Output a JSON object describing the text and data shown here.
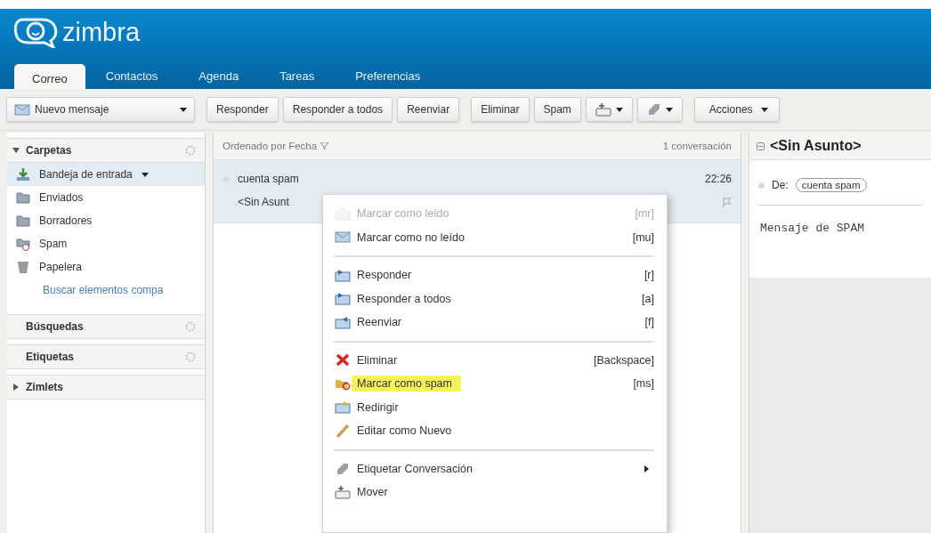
{
  "app": {
    "logo": "zimbra"
  },
  "tabs": [
    {
      "label": "Correo",
      "selected": true
    },
    {
      "label": "Contactos",
      "selected": false
    },
    {
      "label": "Agenda",
      "selected": false
    },
    {
      "label": "Tareas",
      "selected": false
    },
    {
      "label": "Preferencias",
      "selected": false
    }
  ],
  "toolbar": {
    "new_button": "Nuevo mensaje",
    "buttons": [
      {
        "kind": "text",
        "label": "Responder"
      },
      {
        "kind": "text",
        "label": "Responder a todos"
      },
      {
        "kind": "text",
        "label": "Reenviar"
      },
      {
        "kind": "text",
        "label": "Eliminar"
      },
      {
        "kind": "text",
        "label": "Spam"
      },
      {
        "kind": "move"
      },
      {
        "kind": "tag"
      },
      {
        "kind": "menu",
        "label": "Acciones"
      }
    ]
  },
  "sidebar": {
    "sections": [
      {
        "title": "Carpetas",
        "expanded": true,
        "items": [
          {
            "label": "Bandeja de entrada",
            "selected": true
          },
          {
            "label": "Enviados",
            "selected": false
          },
          {
            "label": "Borradores",
            "selected": false
          },
          {
            "label": "Spam",
            "selected": false
          },
          {
            "label": "Papelera",
            "selected": false
          }
        ],
        "link": "Buscar elementos compa"
      },
      {
        "title": "Búsquedas"
      },
      {
        "title": "Etiquetas"
      },
      {
        "title": "Zimlets",
        "expanded": false
      }
    ]
  },
  "message_list": {
    "sort_label": "Ordenado por Fecha",
    "count": "1 conversación",
    "rows": [
      {
        "sender": "cuenta spam",
        "time": "22:26",
        "subject": "<Sin Asunt",
        "selected": true
      }
    ]
  },
  "reading_pane": {
    "subject": "<Sin Asunto>",
    "from_label": "De:",
    "from": "cuenta spam",
    "body": "Mensaje de SPAM"
  },
  "context_menu": {
    "items": [
      {
        "kind": "item",
        "label": "Marcar como leído",
        "shortcut": "[mr]",
        "disabled": true,
        "highlighted": false
      },
      {
        "kind": "item",
        "label": "Marcar como no leído",
        "shortcut": "[mu]",
        "disabled": false,
        "highlighted": false
      },
      {
        "kind": "separator"
      },
      {
        "kind": "item",
        "label": "Responder",
        "shortcut": "[r]",
        "disabled": false,
        "highlighted": false
      },
      {
        "kind": "item",
        "label": "Responder a todos",
        "shortcut": "[a]",
        "disabled": false,
        "highlighted": false
      },
      {
        "kind": "item",
        "label": "Reenviar",
        "shortcut": "[f]",
        "disabled": false,
        "highlighted": false
      },
      {
        "kind": "separator"
      },
      {
        "kind": "item",
        "label": "Eliminar",
        "shortcut": "[Backspace]",
        "disabled": false,
        "highlighted": false
      },
      {
        "kind": "item",
        "label": "Marcar como spam",
        "shortcut": "[ms]",
        "disabled": false,
        "highlighted": true
      },
      {
        "kind": "item",
        "label": "Redirigir",
        "disabled": false,
        "highlighted": false
      },
      {
        "kind": "item",
        "label": "Editar como Nuevo",
        "disabled": false,
        "highlighted": false
      },
      {
        "kind": "separator"
      },
      {
        "kind": "submenu",
        "label": "Etiquetar Conversación",
        "disabled": false,
        "highlighted": false
      },
      {
        "kind": "item",
        "label": "Mover",
        "disabled": false,
        "highlighted": false
      }
    ]
  }
}
